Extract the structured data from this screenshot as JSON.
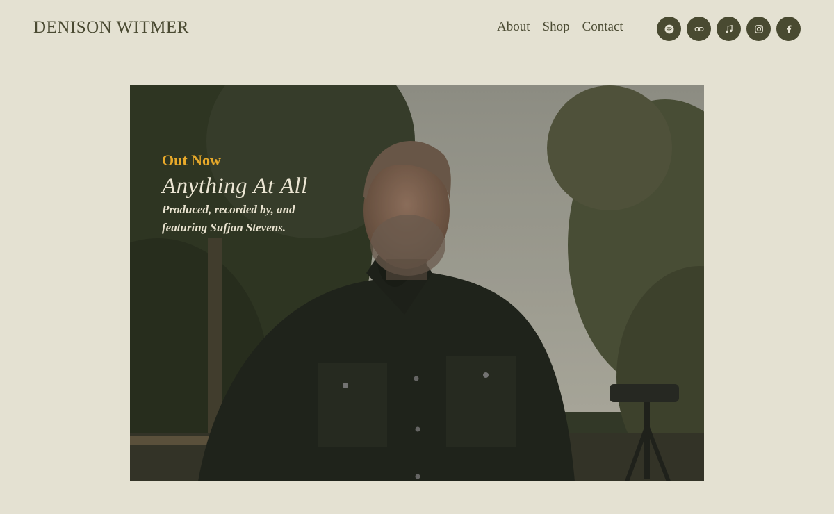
{
  "header": {
    "site_title": "DENISON WITMER",
    "nav": [
      {
        "label": "About"
      },
      {
        "label": "Shop"
      },
      {
        "label": "Contact"
      }
    ],
    "social": [
      {
        "icon": "spotify-icon"
      },
      {
        "icon": "link-icon"
      },
      {
        "icon": "music-note-icon"
      },
      {
        "icon": "instagram-icon"
      },
      {
        "icon": "facebook-icon"
      }
    ]
  },
  "hero": {
    "eyebrow": "Out Now",
    "title": "Anything At All",
    "subtitle": "Produced, recorded by, and featuring Sufjan Stevens."
  },
  "colors": {
    "background": "#e4e1d2",
    "text": "#4a4a32",
    "icon_circle": "#494a31",
    "accent": "#e7a92a"
  }
}
